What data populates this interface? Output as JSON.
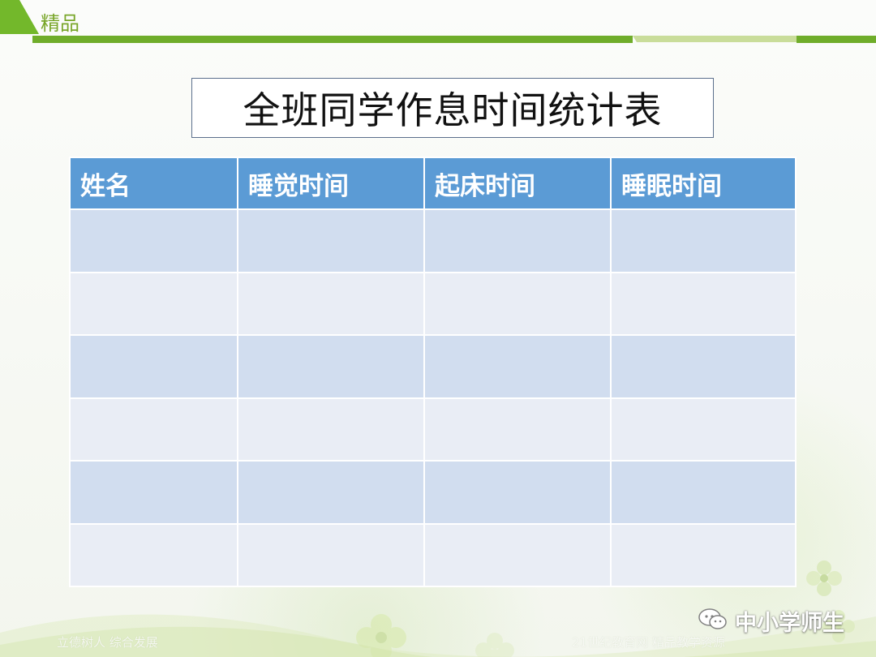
{
  "header": {
    "label": "精品"
  },
  "title": "全班同学作息时间统计表",
  "table": {
    "headers": [
      "姓名",
      "睡觉时间",
      "起床时间",
      "睡眠时间"
    ],
    "rows": [
      [
        "",
        "",
        "",
        ""
      ],
      [
        "",
        "",
        "",
        ""
      ],
      [
        "",
        "",
        "",
        ""
      ],
      [
        "",
        "",
        "",
        ""
      ],
      [
        "",
        "",
        "",
        ""
      ],
      [
        "",
        "",
        "",
        ""
      ]
    ]
  },
  "footer": {
    "left_text": "立德树人 综合发展",
    "right_text": "21世纪教育网 精品教学资源",
    "brand": "中小学师生"
  },
  "icons": {
    "brand_icon": "wechat-icon",
    "decor_icon": "flower-icon"
  },
  "colors": {
    "accent_green": "#79a62a",
    "table_header": "#5b9bd5",
    "table_row_odd": "#d1ddef",
    "table_row_even": "#e9edf5"
  }
}
